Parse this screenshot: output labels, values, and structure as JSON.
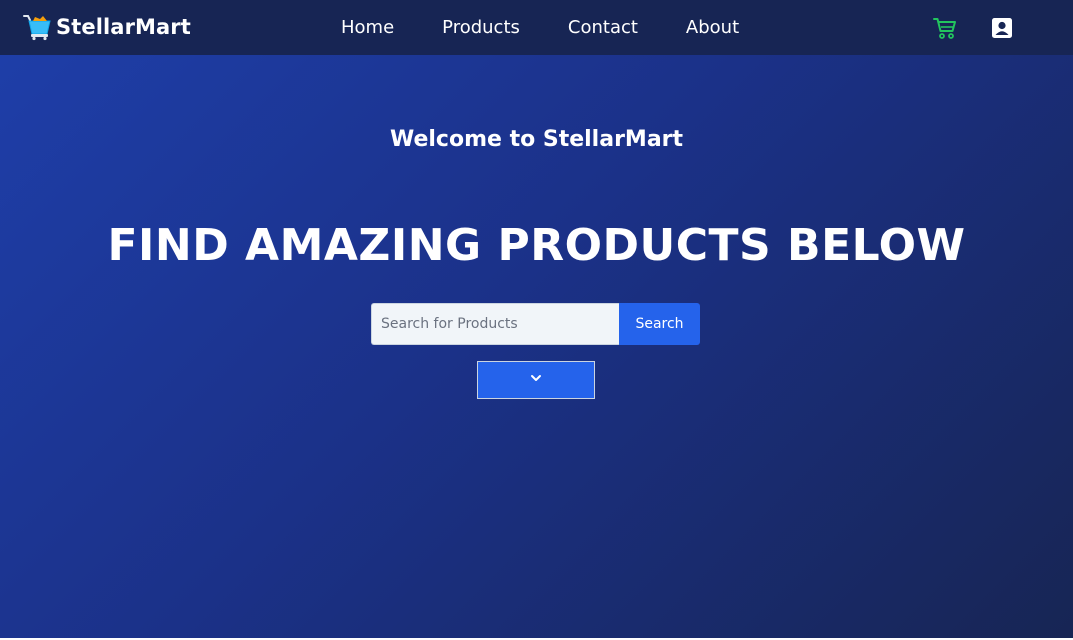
{
  "navbar": {
    "brand_name": "StellarMart",
    "logo_icon": "shopping-basket-logo-icon",
    "links": [
      {
        "label": "Home"
      },
      {
        "label": "Products"
      },
      {
        "label": "Contact"
      },
      {
        "label": "About"
      }
    ],
    "cart_icon": "shopping-cart-icon",
    "account_icon": "user-account-icon"
  },
  "hero": {
    "welcome": "Welcome to StellarMart",
    "headline": "FIND AMAZING PRODUCTS BELOW",
    "search": {
      "placeholder": "Search for Products",
      "value": "",
      "button_label": "Search"
    },
    "dropdown_icon": "chevron-down-icon"
  },
  "colors": {
    "navbar_bg": "#172554",
    "hero_gradient_start": "#1e3ea8",
    "hero_gradient_end": "#172554",
    "accent_blue": "#2563eb",
    "cart_green": "#22c55e",
    "text_white": "#ffffff"
  }
}
